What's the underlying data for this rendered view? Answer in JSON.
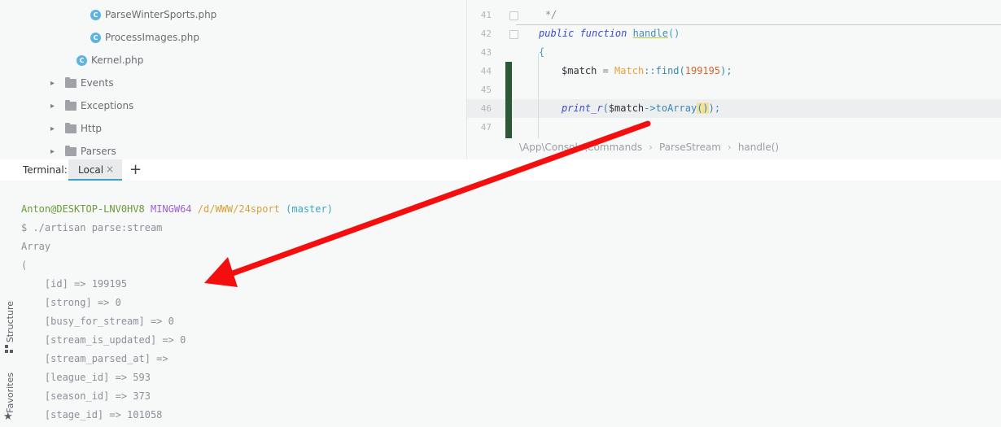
{
  "tree": {
    "items": [
      {
        "label": "ParseWinterSports.php",
        "type": "file"
      },
      {
        "label": "ProcessImages.php",
        "type": "file"
      },
      {
        "label": "Kernel.php",
        "type": "file"
      },
      {
        "label": "Events",
        "type": "folder"
      },
      {
        "label": "Exceptions",
        "type": "folder"
      },
      {
        "label": "Http",
        "type": "folder"
      },
      {
        "label": "Parsers",
        "type": "folder"
      }
    ],
    "file_icon_letter": "C"
  },
  "editor": {
    "line_numbers": [
      "41",
      "42",
      "43",
      "44",
      "45",
      "46",
      "47"
    ],
    "lines": {
      "l41": "*/",
      "l42_kw": "public function ",
      "l42_fn": "handle",
      "l42_rest": "()",
      "l43": "{",
      "l44_var": "$match",
      "l44_eq": " = ",
      "l44_class": "Match",
      "l44_call": "::find(",
      "l44_num": "199195",
      "l44_end": ");",
      "l46_fn": "print_r",
      "l46_open": "(",
      "l46_var": "$match",
      "l46_arrow": "->toArray",
      "l46_parens": "()",
      "l46_end": ");"
    },
    "breadcrumbs": [
      "\\App\\Console\\Commands",
      "ParseStream",
      "handle()"
    ]
  },
  "terminal": {
    "label": "Terminal:",
    "tab": "Local",
    "tab_close": "×",
    "add": "+",
    "prompt": {
      "user": "Anton@DESKTOP-LNV0HV8",
      "env": "MINGW64",
      "path": "/d/WWW/24sport",
      "branch": "(master)"
    },
    "lines": [
      "$ ./artisan parse:stream",
      "Array",
      "(",
      "    [id] => 199195",
      "    [strong] => 0",
      "    [busy_for_stream] => 0",
      "    [stream_is_updated] => 0",
      "    [stream_parsed_at] =>",
      "    [league_id] => 593",
      "    [season_id] => 373",
      "    [stage_id] => 101058"
    ]
  },
  "sidebar": {
    "structure": "Structure",
    "favorites": "Favorites"
  },
  "colors": {
    "arrow": "#f50e0e",
    "change_bar": "#2c5935",
    "tab_underline": "#3b9ecf",
    "prompt_user": "#6a9a3a",
    "prompt_env": "#9e5fd0",
    "prompt_path": "#d4a23a",
    "prompt_branch": "#3aa8c8"
  }
}
